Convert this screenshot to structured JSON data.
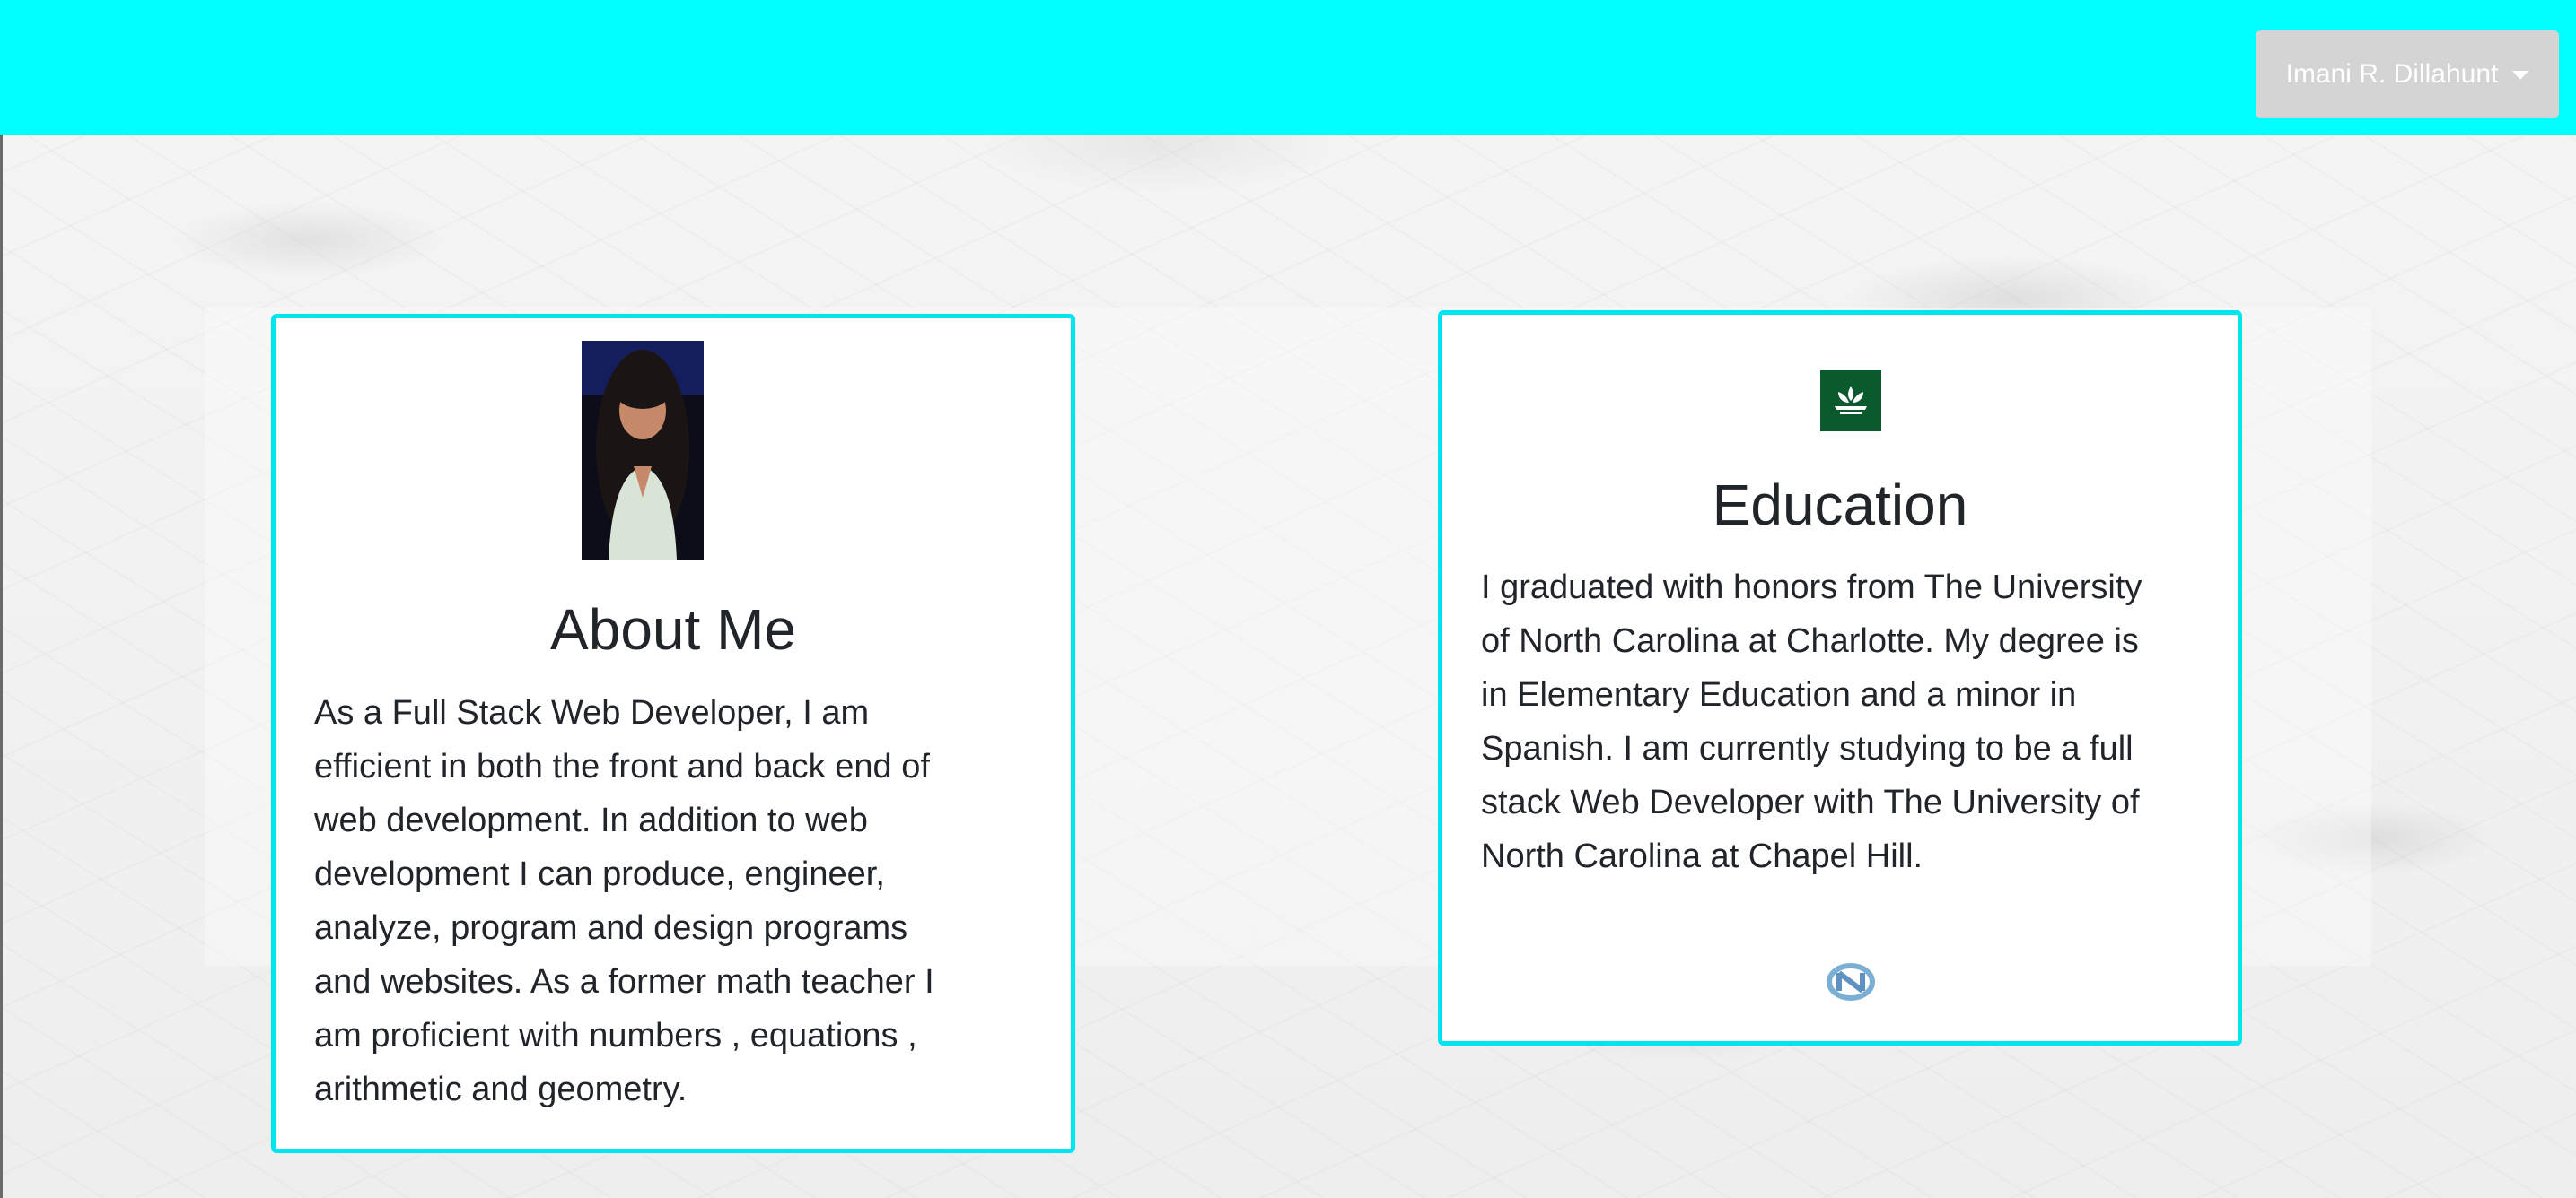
{
  "header": {
    "user_menu_label": "Imani R. Dillahunt",
    "user_menu_icon": "chevron-down-icon",
    "background_color": "#00ffff"
  },
  "about": {
    "photo": "profile-photo",
    "title": "About Me",
    "text": "As a Full Stack Web Developer, I am efficient in both the front and back end of web development. In addition to web development I can produce, engineer, analyze, program and design programs and websites. As a former math teacher I am proficient with numbers , equations , arithmetic and geometry."
  },
  "education": {
    "top_logo": "unc-charlotte-logo",
    "title": "Education",
    "text": "I graduated with honors from The University of North Carolina at Charlotte. My degree is in Elementary Education and a minor in Spanish. I am currently studying to be a full stack Web Developer with The University of North Carolina at Chapel Hill.",
    "bottom_logo": "unc-chapel-hill-logo"
  },
  "colors": {
    "card_border": "#00e5f0",
    "accent": "#00ffff",
    "uncc_green": "#0a5a2e",
    "unc_blue": "#7bafd4"
  }
}
